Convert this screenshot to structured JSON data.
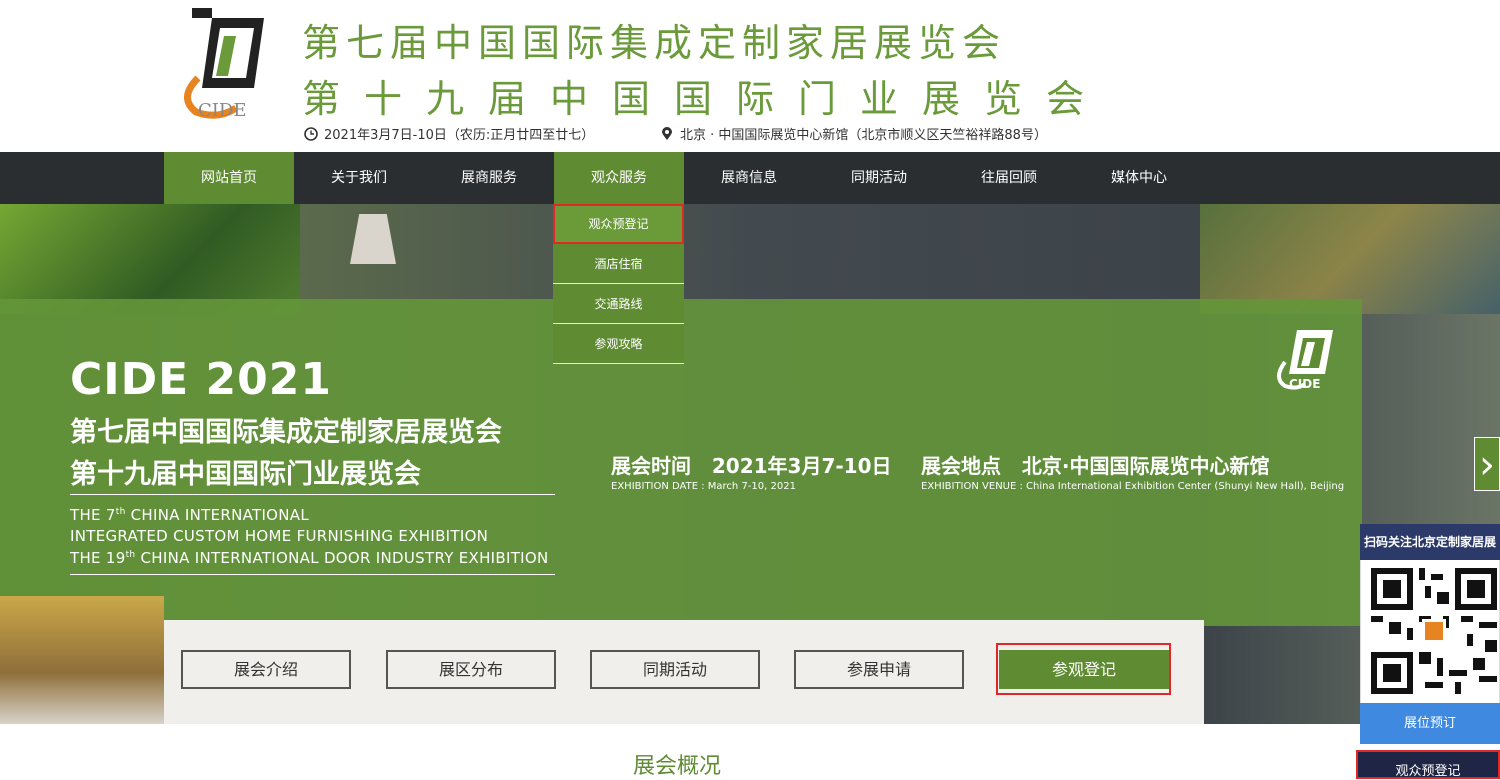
{
  "header": {
    "logo_text": "CIDE",
    "title_line1": "第七届中国国际集成定制家居展览会",
    "title_line2": "第十九届中国国际门业展览会",
    "date_text": "2021年3月7日-10日（农历:正月廿四至廿七）",
    "location_text": "北京 · 中国国际展览中心新馆（北京市顺义区天竺裕祥路88号）",
    "icons": {
      "date": "clock-icon",
      "location": "map-pin-icon"
    }
  },
  "nav": {
    "items": [
      {
        "label": "网站首页",
        "active": true
      },
      {
        "label": "关于我们",
        "active": false
      },
      {
        "label": "展商服务",
        "active": false
      },
      {
        "label": "观众服务",
        "active": true
      },
      {
        "label": "展商信息",
        "active": false
      },
      {
        "label": "同期活动",
        "active": false
      },
      {
        "label": "往届回顾",
        "active": false
      },
      {
        "label": "媒体中心",
        "active": false
      }
    ],
    "dropdown": [
      "观众预登记",
      "酒店住宿",
      "交通路线",
      "参观攻略"
    ]
  },
  "banner": {
    "headline": "CIDE 2021",
    "cn_line1": "第七届中国国际集成定制家居展览会",
    "cn_line2": "第十九届中国国际门业展览会",
    "en_line1_pre": "THE 7",
    "en_line1_sup": "th",
    "en_line1_post": " CHINA INTERNATIONAL",
    "en_line2": "INTEGRATED CUSTOM HOME FURNISHING EXHIBITION",
    "en_line3_pre": "THE 19",
    "en_line3_sup": "th",
    "en_line3_post": " CHINA INTERNATIONAL DOOR INDUSTRY EXHIBITION",
    "time_label": "展会时间",
    "time_value": "2021年3月7-10日",
    "time_sub": "EXHIBITION  DATE :  March  7-10, 2021",
    "venue_label": "展会地点",
    "venue_value": "北京·中国国际展览中心新馆",
    "venue_sub": "EXHIBITION  VENUE :  China International Exhibition Center (Shunyi New Hall), Beijing",
    "logo_small": "CIDE",
    "arrow": "›"
  },
  "buttons": [
    "展会介绍",
    "展区分布",
    "同期活动",
    "参展申请",
    "参观登记"
  ],
  "section_title": "展会概况",
  "side": {
    "header": "扫码关注北京定制家居展",
    "btn1": "展位预订",
    "btn2": "观众预登记"
  },
  "colors": {
    "brand_green": "#5f8b33",
    "nav_bg": "#2b2e31",
    "highlight_red": "#e02828"
  }
}
